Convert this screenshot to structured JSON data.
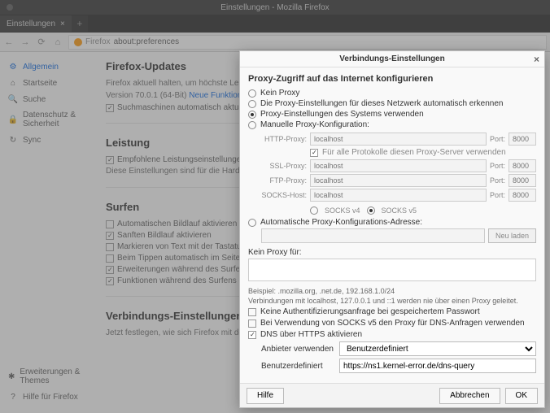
{
  "window": {
    "title": "Einstellungen - Mozilla Firefox"
  },
  "tab": {
    "label": "Einstellungen"
  },
  "urlbar": {
    "prefix": "Firefox",
    "url": "about:preferences"
  },
  "sidebar": {
    "items": [
      {
        "label": "Allgemein"
      },
      {
        "label": "Startseite"
      },
      {
        "label": "Suche"
      },
      {
        "label": "Datenschutz & Sicherheit"
      },
      {
        "label": "Sync"
      }
    ],
    "bottom": [
      {
        "label": "Erweiterungen & Themes"
      },
      {
        "label": "Hilfe für Firefox"
      }
    ]
  },
  "main": {
    "updates": {
      "heading": "Firefox-Updates",
      "line1_a": "Firefox aktuell halten, um höchste Leistung, S",
      "line2_a": "Version 70.0.1 (64-Bit) ",
      "line2_link": "Neue Funktionen und Ä",
      "chk1": "Suchmaschinen automatisch aktualisiere"
    },
    "perf": {
      "heading": "Leistung",
      "chk1": "Empfohlene Leistungseinstellungen verwe",
      "note": "Diese Einstellungen sind für die Hardware und"
    },
    "browse": {
      "heading": "Surfen",
      "chk1": "Automatischen Bildlauf aktivieren",
      "chk2": "Sanften Bildlauf aktivieren",
      "chk3": "Markieren von Text mit der Tastatur zulass",
      "chk4": "Beim Tippen automatisch im Seitentext s",
      "chk5": "Erweiterungen während des Surfens emp",
      "chk6": "Funktionen während des Surfens empfeh"
    },
    "conn": {
      "heading": "Verbindungs-Einstellungen",
      "line": "Jetzt festlegen, wie sich Firefox mit dem Intern"
    }
  },
  "dialog": {
    "title": "Verbindungs-Einstellungen",
    "h3": "Proxy-Zugriff auf das Internet konfigurieren",
    "r1": "Kein Proxy",
    "r2": "Die Proxy-Einstellungen für dieses Netzwerk automatisch erkennen",
    "r3": "Proxy-Einstellungen des Systems verwenden",
    "r4": "Manuelle Proxy-Konfiguration:",
    "http_lbl": "HTTP-Proxy:",
    "ssl_lbl": "SSL-Proxy:",
    "ftp_lbl": "FTP-Proxy:",
    "socks_lbl": "SOCKS-Host:",
    "port_lbl": "Port:",
    "host_ph": "localhost",
    "port_ph": "8000",
    "same_chk": "Für alle Protokolle diesen Proxy-Server verwenden",
    "socks_v4": "SOCKS v4",
    "socks_v5": "SOCKS v5",
    "r5": "Automatische Proxy-Konfigurations-Adresse:",
    "reload": "Neu laden",
    "noproxy_lbl": "Kein Proxy für:",
    "example": "Beispiel: .mozilla.org, .net.de, 192.168.1.0/24",
    "local_note": "Verbindungen mit localhost, 127.0.0.1 und ::1 werden nie über einen Proxy geleitet.",
    "chk_auth": "Keine Authentifizierungsanfrage bei gespeichertem Passwort",
    "chk_socks_dns": "Bei Verwendung von SOCKS v5 den Proxy für DNS-Anfragen verwenden",
    "chk_doh": "DNS über HTTPS aktivieren",
    "provider_lbl": "Anbieter verwenden",
    "provider_val": "Benutzerdefiniert",
    "custom_lbl": "Benutzerdefiniert",
    "custom_val": "https://ns1.kernel-error.de/dns-query",
    "help": "Hilfe",
    "cancel": "Abbrechen",
    "ok": "OK"
  }
}
